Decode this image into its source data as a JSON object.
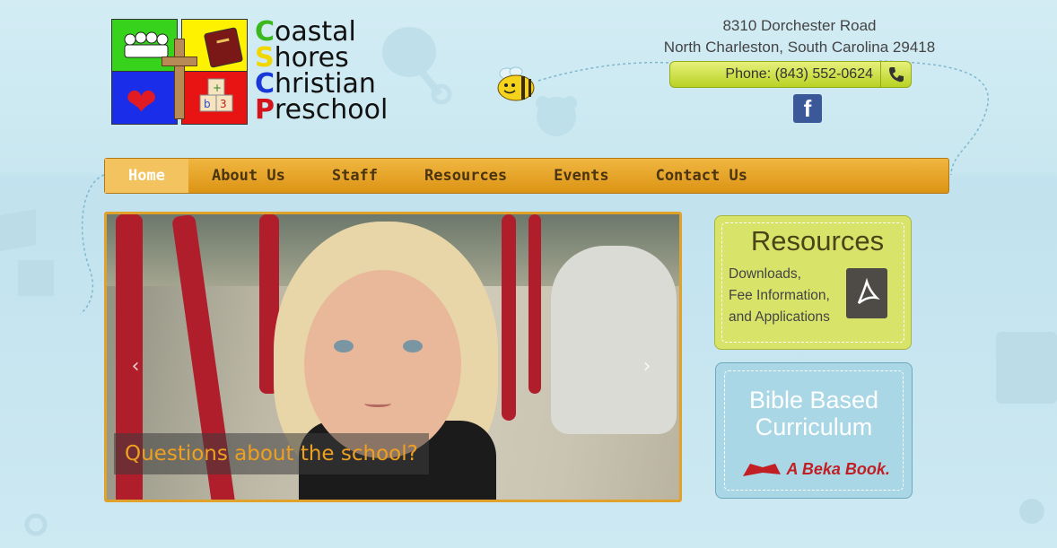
{
  "logo": {
    "line1_first": "C",
    "line1_rest": "oastal",
    "line2_first": "S",
    "line2_rest": "hores",
    "line3_first": "C",
    "line3_rest": "hristian",
    "line4_first": "P",
    "line4_rest": "reschool"
  },
  "contact": {
    "address_line1": "8310 Dorchester Road",
    "address_line2": "North Charleston, South Carolina 29418",
    "phone": "Phone: (843) 552-0624"
  },
  "social": {
    "facebook_glyph": "f"
  },
  "nav": {
    "items": [
      {
        "label": "Home",
        "active": true
      },
      {
        "label": "About Us"
      },
      {
        "label": "Staff"
      },
      {
        "label": "Resources"
      },
      {
        "label": "Events"
      },
      {
        "label": "Contact Us"
      }
    ]
  },
  "slider": {
    "caption": "Questions about the school?",
    "prev_glyph": "‹",
    "next_glyph": "›"
  },
  "resources_box": {
    "title": "Resources",
    "line1": "Downloads,",
    "line2": "Fee Information,",
    "line3": "and Applications"
  },
  "bible_box": {
    "title_line1": "Bible Based",
    "title_line2": "Curriculum",
    "brand": "A Beka Book."
  },
  "colors": {
    "nav_bg": "#e3a226",
    "accent_green": "#d8e36a",
    "accent_blue": "#a9d7e6",
    "caption_text": "#f0a020"
  }
}
